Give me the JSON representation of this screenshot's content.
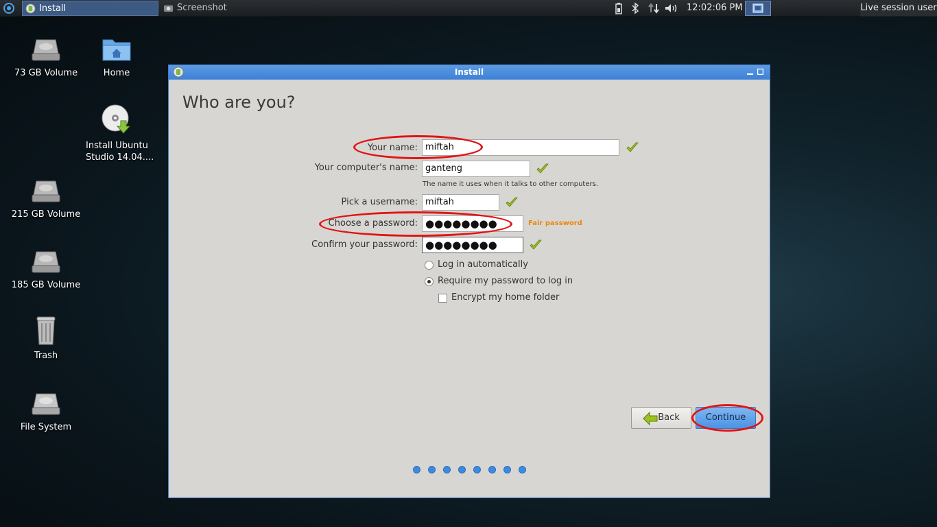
{
  "panel": {
    "tasks": [
      {
        "label": "Install",
        "active": true
      },
      {
        "label": "Screenshot",
        "active": false
      }
    ],
    "clock": "12:02:06 PM",
    "user": "Live session user"
  },
  "desktop": [
    {
      "label": "73 GB Volume",
      "icon": "drive-icon"
    },
    {
      "label": "Home",
      "icon": "home-folder-icon"
    },
    {
      "label": "Install Ubuntu Studio 14.04....",
      "icon": "install-disc-icon"
    },
    {
      "label": "215 GB Volume",
      "icon": "drive-icon"
    },
    {
      "label": "185 GB Volume",
      "icon": "drive-icon"
    },
    {
      "label": "Trash",
      "icon": "trash-icon"
    },
    {
      "label": "File System",
      "icon": "drive-icon"
    }
  ],
  "window": {
    "title": "Install",
    "heading": "Who are you?",
    "form": {
      "name_label": "Your name:",
      "name_value": "miftah",
      "computer_label": "Your computer's name:",
      "computer_value": "ganteng",
      "computer_hint": "The name it uses when it talks to other computers.",
      "username_label": "Pick a username:",
      "username_value": "miftah",
      "password_label": "Choose a password:",
      "password_value": "●●●●●●●●",
      "password_strength": "Fair password",
      "confirm_label": "Confirm your password:",
      "confirm_value": "●●●●●●●●"
    },
    "options": {
      "login_auto": "Log in automatically",
      "require_password": "Require my password to log in",
      "encrypt_home": "Encrypt my home folder",
      "selected": "require_password",
      "encrypt_checked": false
    },
    "buttons": {
      "back": "Back",
      "continue": "Continue"
    },
    "progress": {
      "steps": 8
    }
  },
  "colors": {
    "accent": "#3c7fd6",
    "annotation": "#e01414",
    "strength": "#e8880c",
    "check": "#9bc21e"
  }
}
